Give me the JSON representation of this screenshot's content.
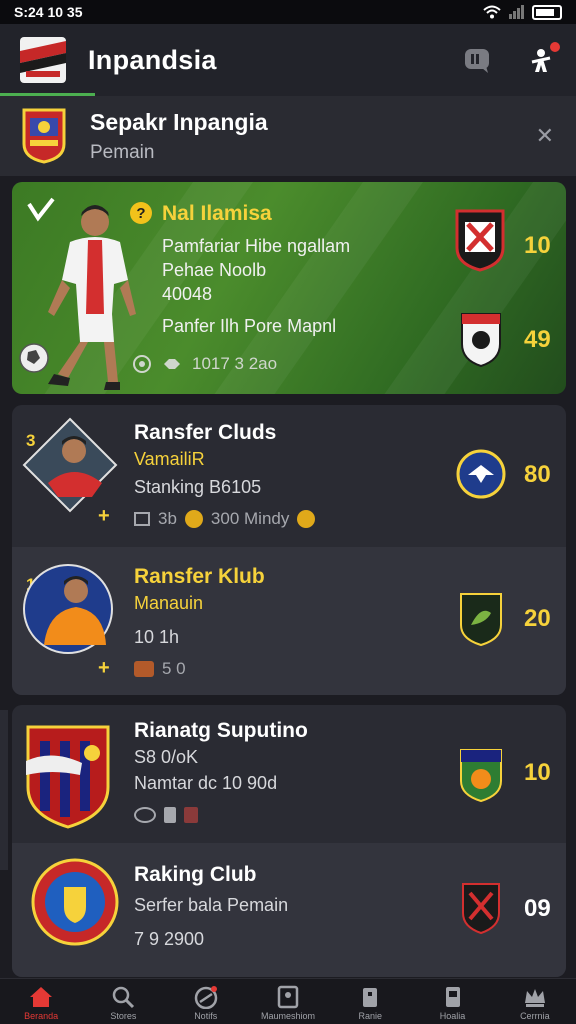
{
  "status_bar": {
    "time": "S:24 10 35"
  },
  "header": {
    "title": "Inpandsia"
  },
  "sub_header": {
    "title": "Sepakr Inpangia",
    "subtitle": "Pemain"
  },
  "featured": {
    "name": "Nal Ilamisa",
    "line1": "Pamfariar Hibe ngallam",
    "line2": "Pehae Noolb",
    "line3": "40048",
    "line4": "Panfer Ilh Pore Mapnl",
    "meta_value": "1017  3 2ao",
    "score_top": "10",
    "score_bottom": "49"
  },
  "list": [
    {
      "rank": "3",
      "title": "Ransfer Cluds",
      "subtitle": "VamailiR",
      "line": "Stanking B6105",
      "meta_a": "3b",
      "meta_b": "300 Mindy",
      "score": "80"
    },
    {
      "rank": "1",
      "title": "Ransfer Klub",
      "subtitle": "Manauin",
      "line": "10 1h",
      "meta_a": "5 0",
      "score": "20"
    },
    {
      "title": "Rianatg Suputino",
      "line1": "S8 0/oK",
      "line2": "Namtar dc 10 90d",
      "score": "10"
    },
    {
      "title": "Raking Club",
      "line1": "Serfer bala Pemain",
      "line2": "7 9 2900",
      "score": "09"
    }
  ],
  "nav": [
    {
      "label": "Beranda",
      "icon": "home-icon"
    },
    {
      "label": "Stores",
      "icon": "search-icon"
    },
    {
      "label": "Notifs",
      "icon": "ball-icon"
    },
    {
      "label": "Maumeshiom",
      "icon": "card-icon"
    },
    {
      "label": "Ranie",
      "icon": "shirt-icon"
    },
    {
      "label": "Hoalia",
      "icon": "trophy-icon"
    },
    {
      "label": "Cerrnia",
      "icon": "crown-icon"
    }
  ],
  "colors": {
    "accent": "#f6d23b",
    "brand_green": "#4b8c2c",
    "alert": "#e53935"
  }
}
